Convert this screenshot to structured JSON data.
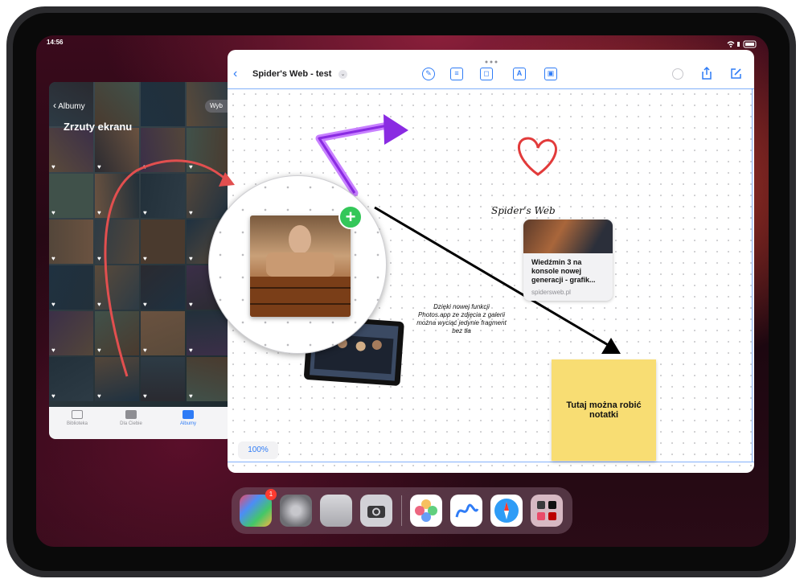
{
  "status": {
    "time": "14:56"
  },
  "photos": {
    "back_label": "Albumy",
    "title": "Zrzuty ekranu",
    "select_label": "Wyb",
    "tabs": [
      "Biblioteka",
      "Dla Ciebie",
      "Albumy"
    ],
    "active_tab": "Albumy"
  },
  "freeform": {
    "board_title": "Spider's Web - test",
    "zoom": "100%",
    "handwritten_label": "Spider's Web",
    "caption": "Dzięki nowej funkcji Photos.app ze zdjęcia z galerii można wyciąć jedynie fragment bez tła",
    "sticky_note": "Tutaj można robić notatki",
    "link_card": {
      "title": "Wiedźmin 3 na konsole nowej generacji - grafik...",
      "domain": "spidersweb.pl"
    }
  },
  "dock": {
    "apps": [
      "App Library",
      "Settings",
      "Contacts",
      "Camera",
      "Photos",
      "Freeform",
      "Safari",
      "App Folder"
    ],
    "app_library_badge": "1"
  },
  "colors": {
    "accent": "#2f7cf6",
    "sticky": "#f8dd73",
    "add_button": "#34c759",
    "arrow_purple": "#9b3fe0",
    "heart_red": "#e23b3b"
  }
}
